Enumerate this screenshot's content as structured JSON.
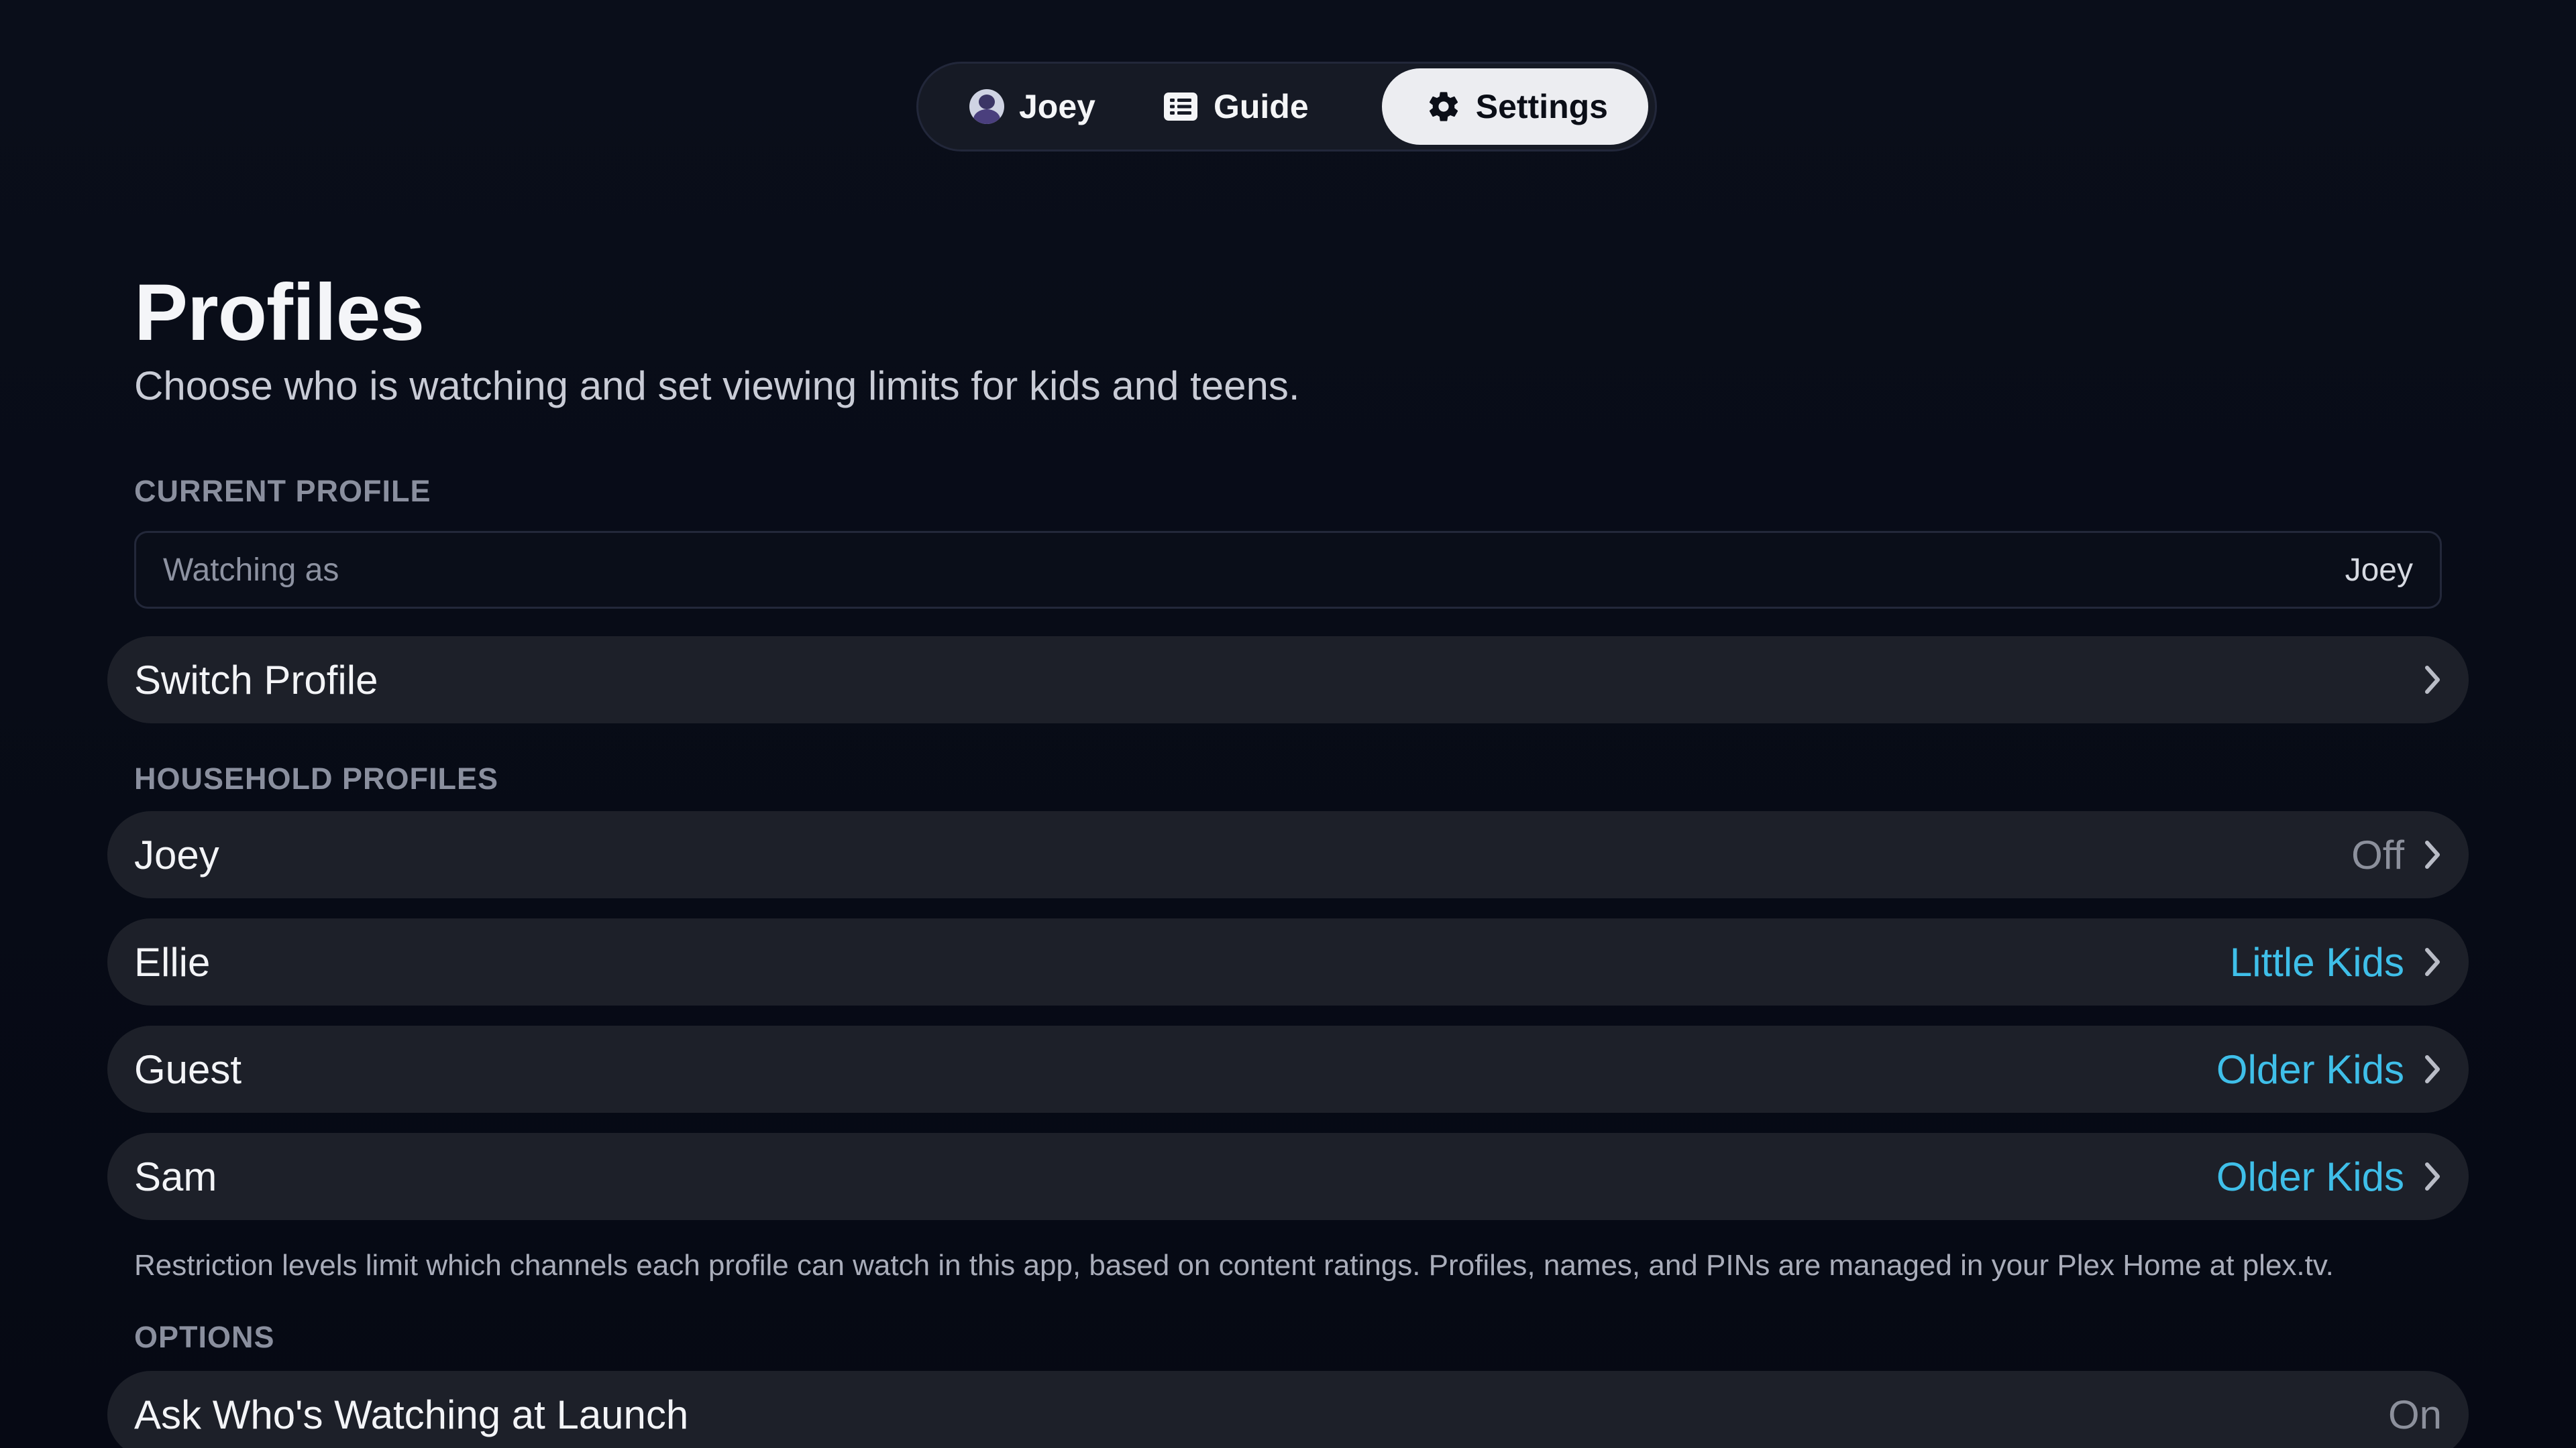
{
  "nav": {
    "profile_label": "Joey",
    "guide_label": "Guide",
    "settings_label": "Settings",
    "icons": {
      "profile": "user-avatar",
      "guide": "guide-list-icon",
      "settings": "gear-icon"
    }
  },
  "page": {
    "title": "Profiles",
    "subtitle": "Choose who is watching and set viewing limits for kids and teens."
  },
  "current_profile": {
    "section_label": "CURRENT PROFILE",
    "watching_as_label": "Watching as",
    "watching_as_value": "Joey",
    "switch_label": "Switch Profile"
  },
  "household": {
    "section_label": "HOUSEHOLD PROFILES",
    "profiles": [
      {
        "name": "Joey",
        "restriction": "Off"
      },
      {
        "name": "Ellie",
        "restriction": "Little Kids"
      },
      {
        "name": "Guest",
        "restriction": "Older Kids"
      },
      {
        "name": "Sam",
        "restriction": "Older Kids"
      }
    ],
    "note": "Restriction levels limit which channels each profile can watch in this app, based on content ratings. Profiles, names, and PINs are managed in your Plex Home at plex.tv."
  },
  "options": {
    "section_label": "OPTIONS",
    "items": [
      {
        "label": "Ask Who's Watching at Launch",
        "value": "On"
      }
    ]
  },
  "colors": {
    "background": "#070b16",
    "row": "#1d2029",
    "accent": "#3fbfe9",
    "muted_value": "#8c909c",
    "selected_tab": "#ecedf1"
  }
}
